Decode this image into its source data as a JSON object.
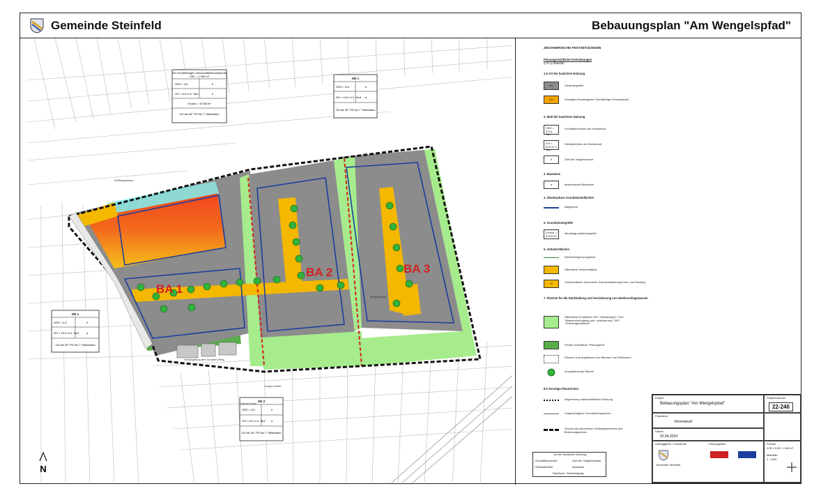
{
  "header": {
    "municipality": "Gemeinde Steinfeld",
    "plan_title": "Bebauungsplan \"Am Wengelspfad\""
  },
  "map": {
    "zones": [
      "BA 1",
      "BA 2",
      "BA 3"
    ],
    "zone_color": "#d42020",
    "colors": {
      "gewerbe": "#8c8c8c",
      "sondergebiet": "#f4a300",
      "public_green": "#a6ec8c",
      "private_green": "#5aae4a",
      "traffic": "#f4b800",
      "emission_red": "#f03c20",
      "boundary": "#111111",
      "blue_line": "#1b3e9e"
    },
    "keys": [
      {
        "title": "SO Großflächiger Lebensmitteleinzelhandel",
        "sub": "VKF = 1.350 m²",
        "r1a": "GRZ = 0,8",
        "r1b": "II",
        "r2a": "GH = 8,0 m ü. Tauf",
        "r2b": "a",
        "r3": "Grokrd. = 8.000 m²",
        "r4": "GD bis 35° PD bis 7° Walmdach"
      },
      {
        "title": "GE 1",
        "r1a": "GRZ = 0,8",
        "r1b": "II",
        "r2a": "GH = 10,0 m ü. Tauf",
        "r2b": "a",
        "r4": "GD bis 35° PD bis 7° Walmdach"
      },
      {
        "title": "GE 1",
        "r1a": "GRZ = 0,8",
        "r1b": "II",
        "r2a": "GH = 10,0 m ü. Tauf",
        "r2b": "a",
        "r4": "GD bis 35° PD bis 7° Walmdach"
      },
      {
        "title": "GE 2",
        "r1a": "GRZ = 0,8",
        "r1b": "II",
        "r2a": "GH = 8,0 m ü. Tauf",
        "r2b": "a",
        "r4": "GD bis 35° PD bis 7° Walmdach"
      }
    ],
    "usage_legend": {
      "title": "Art der baulichen Nutzung",
      "c1": "Grundflächenzahl",
      "c2": "Zahl der Vollgeschosse",
      "c3": "Gebäudehöhe",
      "c4": "Bauweise",
      "c5": "Dachform / Dachneigung"
    },
    "road_labels": [
      "Verlängerung des Vorderes Ring",
      "Lange Länder",
      "Unterm Keller",
      "Wingertsweg",
      "Kleibergstrasse"
    ],
    "north": "N"
  },
  "legend": {
    "heading": "ZEICHNERISCHE FESTSETZUNGEN",
    "sub_heading": "Planungsrechtliche Festsetzungen",
    "sub_ref": "(§ 9 (1) BauGB)",
    "section1": "1.0   Art der baulichen Nutzung",
    "items1": [
      {
        "label": "GE",
        "text": "Gewerbegebiet"
      },
      {
        "label": "SO",
        "text": "Sonstiges Sondergebiet Großflächiger Einzelhandel"
      }
    ],
    "section2": "2.     Maß der baulichen Nutzung",
    "items2": [
      {
        "label": "GRZ = 0,8 a. Tauf",
        "text": "Grundflächenzahl als Höchstmaß"
      },
      {
        "label": "GH = 8,00 m ü. Tauf",
        "text": "Gebäudehöhe als Höchstmaß"
      },
      {
        "label": "II",
        "text": "Zahl der Vollgeschosse"
      }
    ],
    "section3": "3.     Bauweise",
    "items3": [
      {
        "label": "a",
        "text": "abweichende Bauweise"
      }
    ],
    "section4": "4.     Überbaubare Grundstücksflächen",
    "items4": [
      {
        "label": "",
        "text": "Baugrenze"
      }
    ],
    "section5": "5.     Grundstücksgröße",
    "items5": [
      {
        "label": "Grokrd. = 8.000 m²",
        "text": "Mindestgrundstücksgröße"
      }
    ],
    "section6": "6.     Verkehrsflächen",
    "items6": [
      {
        "label": "",
        "text": "Straßenbegrenzungslinie"
      },
      {
        "label": "",
        "text": "Öffentliche Verkehrsfläche"
      },
      {
        "label": "R",
        "text": "Verkehrsfläche besonderer Zweckbestimmung Geh- und Radweg"
      }
    ],
    "section7": "7.     Flächen für die Rückhaltung und Versickerung von Niederschlagswasser",
    "items7": [
      {
        "label": "",
        "text": "Öffentliche Grünfläche  Ö01 \"Ortsrandgrün\"  Ö02 \"Wasserrückhaltung und -versickerung\"  Ö03 \"Ortsrandgrünfläche\""
      },
      {
        "label": "",
        "text": "Private Grünfläche \"Pflanzgebot\""
      },
      {
        "label": "",
        "text": "Flächen zum Anpflanzen von Bäumen und Sträuchern"
      },
      {
        "label": "",
        "text": "anzupflanzende Bäume"
      }
    ],
    "section8": "8.0    Sonstige Planzeichen",
    "items8": [
      {
        "label": "",
        "text": "Abgrenzung unterschiedlicher Nutzung"
      },
      {
        "label": "",
        "text": "Vorgeschlagene Grundstücksgrenzen"
      },
      {
        "label": "",
        "text": "Grenze des räumlichen Geltungsbereiches des Bebauungsplanes"
      }
    ]
  },
  "titleblock": {
    "project_label": "Projekt",
    "project_name": "Bebauungsplan \"Am Wengelspfad\"",
    "project_no_label": "Projektnummer",
    "project_no": "22-246",
    "phase_label": "Planstand",
    "phase": "Vorentwurf",
    "date_label": "Datum",
    "date": "02.04.2024",
    "format_label": "Format",
    "format": "1,00 x 0,60 = 0,60 m²",
    "scale_label": "Maßstab",
    "scale": "1 : 1000",
    "client_label": "Auftraggeber / Gemeinde",
    "client": "Gemeinde Steinfeld",
    "planner_label": "Planungsbüro"
  }
}
